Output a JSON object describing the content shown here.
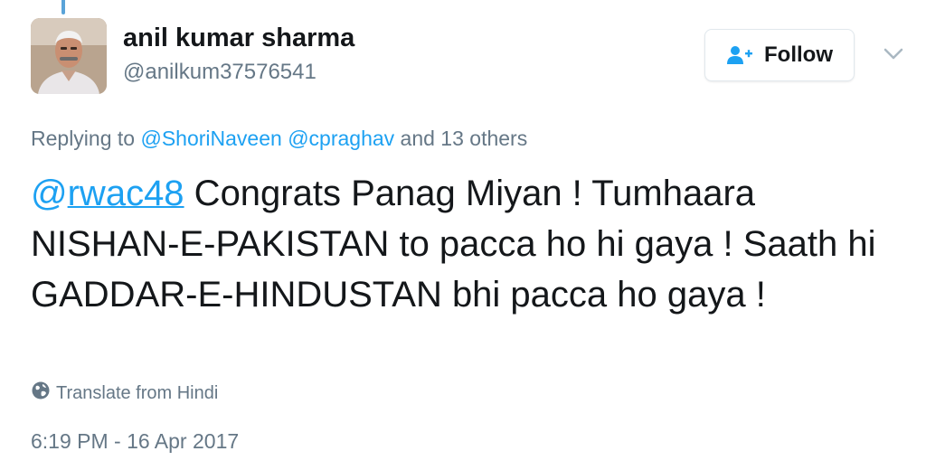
{
  "user": {
    "display_name": "anil kumar sharma",
    "handle": "@anilkum37576541"
  },
  "follow_button": {
    "label": "Follow",
    "icon": "add-person-icon"
  },
  "more_menu": {
    "icon": "chevron-down-icon"
  },
  "replying": {
    "prefix": "Replying to",
    "mentions": [
      "@ShoriNaveen",
      "@cpraghav"
    ],
    "others": "and 13 others"
  },
  "tweet": {
    "mention_at": "@",
    "mention_name": "rwac48",
    "text": " Congrats Panag Miyan ! Tumhaara NISHAN-E-PAKISTAN to pacca ho hi gaya ! Saath hi GADDAR-E-HINDUSTAN bhi pacca ho gaya !"
  },
  "translate": {
    "label": "Translate from Hindi",
    "icon": "globe-icon"
  },
  "timestamp": "6:19 PM - 16 Apr 2017",
  "colors": {
    "link": "#1da1f2",
    "secondary_text": "#657786",
    "primary_text": "#14171a",
    "thread_line": "#5aa3d8"
  }
}
